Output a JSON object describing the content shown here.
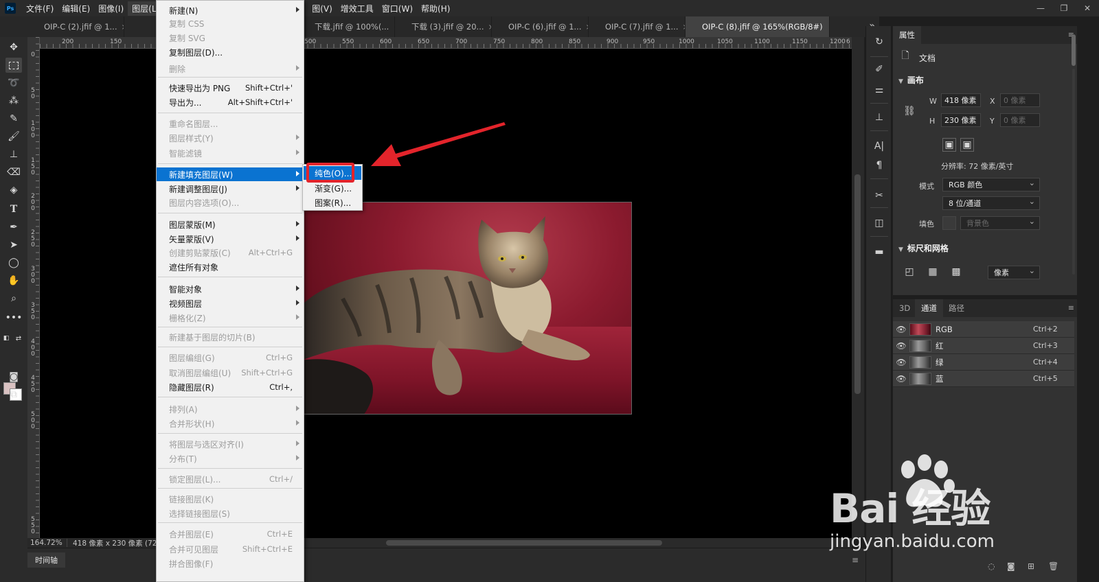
{
  "menubar": {
    "logo": "Ps",
    "items": [
      "文件(F)",
      "编辑(E)",
      "图像(I)",
      "图层(L)",
      "图(V)",
      "增效工具",
      "窗口(W)",
      "帮助(H)"
    ],
    "window_controls": [
      "—",
      "❐",
      "✕"
    ]
  },
  "tabs": [
    {
      "label": "OIP-C (2).jfif @ 1..."
    },
    {
      "label": "下载.jfif @ 100%(..."
    },
    {
      "label": "下载 (3).jfif @ 20..."
    },
    {
      "label": "OIP-C (6).jfif @ 1..."
    },
    {
      "label": "OIP-C (7).jfif @ 1..."
    },
    {
      "label": "OIP-C (8).jfif @ 165%(RGB/8#)"
    }
  ],
  "tab_close": "×",
  "tab_overflow": "»",
  "ruler_top": [
    "200",
    "150",
    "500",
    "550",
    "600",
    "650",
    "700",
    "750",
    "800",
    "850",
    "900",
    "950",
    "1000",
    "1050",
    "1100",
    "1150",
    "1200",
    "6"
  ],
  "ruler_left": [
    "0",
    "5",
    "0",
    "1",
    "0",
    "0",
    "1",
    "5",
    "0",
    "2",
    "0",
    "0",
    "2",
    "5",
    "0",
    "3",
    "0",
    "0",
    "3",
    "5",
    "0",
    "4",
    "0",
    "0",
    "4",
    "5",
    "0",
    "5",
    "0",
    "0",
    "5",
    "5",
    "0"
  ],
  "statusbar": {
    "zoom": "164.72%",
    "doc_size": "418 像素 x 230 像素 (72"
  },
  "timeline": {
    "tab": "时间轴",
    "menu": "≡"
  },
  "layer_menu": {
    "items": [
      {
        "label": "新建(N)",
        "shortcut": "",
        "submenu": true,
        "disabled": false
      },
      {
        "label": "复制 CSS",
        "shortcut": "",
        "submenu": false,
        "disabled": true
      },
      {
        "label": "复制 SVG",
        "shortcut": "",
        "submenu": false,
        "disabled": true
      },
      {
        "label": "复制图层(D)...",
        "shortcut": "",
        "submenu": false,
        "disabled": false
      },
      {
        "label": "删除",
        "shortcut": "",
        "submenu": true,
        "disabled": true
      },
      {
        "label": "快速导出为 PNG",
        "shortcut": "Shift+Ctrl+'",
        "submenu": false,
        "disabled": false
      },
      {
        "label": "导出为...",
        "shortcut": "Alt+Shift+Ctrl+'",
        "submenu": false,
        "disabled": false
      },
      {
        "label": "重命名图层...",
        "shortcut": "",
        "submenu": false,
        "disabled": true
      },
      {
        "label": "图层样式(Y)",
        "shortcut": "",
        "submenu": true,
        "disabled": true
      },
      {
        "label": "智能滤镜",
        "shortcut": "",
        "submenu": true,
        "disabled": true
      },
      {
        "label": "新建填充图层(W)",
        "shortcut": "",
        "submenu": true,
        "disabled": false
      },
      {
        "label": "新建调整图层(J)",
        "shortcut": "",
        "submenu": true,
        "disabled": false
      },
      {
        "label": "图层内容选项(O)...",
        "shortcut": "",
        "submenu": false,
        "disabled": true
      },
      {
        "label": "图层蒙版(M)",
        "shortcut": "",
        "submenu": true,
        "disabled": false
      },
      {
        "label": "矢量蒙版(V)",
        "shortcut": "",
        "submenu": true,
        "disabled": false
      },
      {
        "label": "创建剪贴蒙版(C)",
        "shortcut": "Alt+Ctrl+G",
        "submenu": false,
        "disabled": true
      },
      {
        "label": "遮住所有对象",
        "shortcut": "",
        "submenu": false,
        "disabled": false
      },
      {
        "label": "智能对象",
        "shortcut": "",
        "submenu": true,
        "disabled": false
      },
      {
        "label": "视频图层",
        "shortcut": "",
        "submenu": true,
        "disabled": false
      },
      {
        "label": "栅格化(Z)",
        "shortcut": "",
        "submenu": true,
        "disabled": true
      },
      {
        "label": "新建基于图层的切片(B)",
        "shortcut": "",
        "submenu": false,
        "disabled": true
      },
      {
        "label": "图层编组(G)",
        "shortcut": "Ctrl+G",
        "submenu": false,
        "disabled": true
      },
      {
        "label": "取消图层编组(U)",
        "shortcut": "Shift+Ctrl+G",
        "submenu": false,
        "disabled": true
      },
      {
        "label": "隐藏图层(R)",
        "shortcut": "Ctrl+,",
        "submenu": false,
        "disabled": false
      },
      {
        "label": "排列(A)",
        "shortcut": "",
        "submenu": true,
        "disabled": true
      },
      {
        "label": "合并形状(H)",
        "shortcut": "",
        "submenu": true,
        "disabled": true
      },
      {
        "label": "将图层与选区对齐(I)",
        "shortcut": "",
        "submenu": true,
        "disabled": true
      },
      {
        "label": "分布(T)",
        "shortcut": "",
        "submenu": true,
        "disabled": true
      },
      {
        "label": "锁定图层(L)...",
        "shortcut": "Ctrl+/",
        "submenu": false,
        "disabled": true
      },
      {
        "label": "链接图层(K)",
        "shortcut": "",
        "submenu": false,
        "disabled": true
      },
      {
        "label": "选择链接图层(S)",
        "shortcut": "",
        "submenu": false,
        "disabled": true
      },
      {
        "label": "合并图层(E)",
        "shortcut": "Ctrl+E",
        "submenu": false,
        "disabled": true
      },
      {
        "label": "合并可见图层",
        "shortcut": "Shift+Ctrl+E",
        "submenu": false,
        "disabled": true
      },
      {
        "label": "拼合图像(F)",
        "shortcut": "",
        "submenu": false,
        "disabled": true
      }
    ]
  },
  "fill_submenu": {
    "items": [
      "纯色(O)...",
      "渐变(G)...",
      "图案(R)..."
    ]
  },
  "properties": {
    "tabs": [
      "属性"
    ],
    "doc_label": "文档",
    "canvas_title": "画布",
    "w_label": "W",
    "w_value": "418 像素",
    "h_label": "H",
    "h_value": "230 像素",
    "x_label": "X",
    "x_placeholder": "0 像素",
    "y_label": "Y",
    "y_placeholder": "0 像素",
    "resolution": "分辨率: 72 像素/英寸",
    "mode_label": "模式",
    "mode_value": "RGB 颜色",
    "depth_value": "8 位/通道",
    "fill_label": "填色",
    "fill_value": "背景色",
    "rulers_title": "标尺和网格",
    "unit_value": "像素"
  },
  "channels": {
    "tabs": [
      "3D",
      "通道",
      "路径"
    ],
    "rows": [
      {
        "name": "RGB",
        "shortcut": "Ctrl+2"
      },
      {
        "name": "红",
        "shortcut": "Ctrl+3"
      },
      {
        "name": "绿",
        "shortcut": "Ctrl+4"
      },
      {
        "name": "蓝",
        "shortcut": "Ctrl+5"
      }
    ]
  },
  "colors": {
    "menu_highlight": "#0a73d1",
    "annotation_red": "#e3242b",
    "canvas_bg": "#000000",
    "foreground": "#d9c1c1",
    "background": "#ffffff"
  },
  "watermark": {
    "brand": "Bai 经验",
    "url": "jingyan.baidu.com"
  }
}
